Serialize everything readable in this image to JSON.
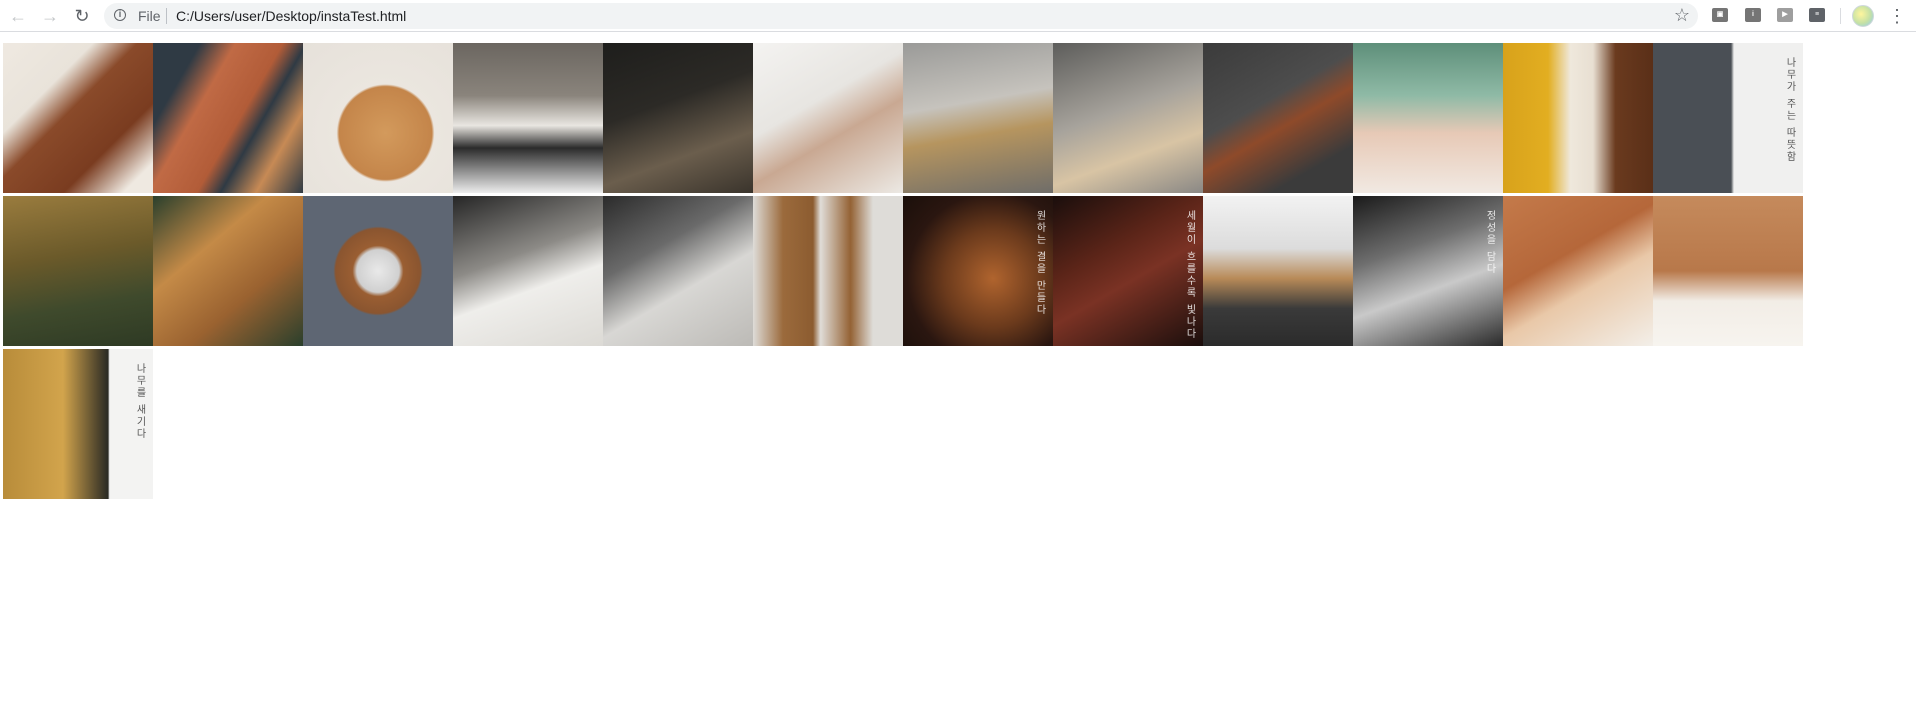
{
  "browser": {
    "scheme_label": "File",
    "url": "C:/Users/user/Desktop/instaTest.html",
    "icons": {
      "back": "arrow-left-icon",
      "forward": "arrow-right-icon",
      "reload": "reload-icon",
      "info": "info-icon",
      "star": "star-icon",
      "menu": "kebab-menu-icon"
    },
    "extensions": [
      "ext-1",
      "ext-2",
      "ext-3",
      "ext-4"
    ]
  },
  "grid": {
    "tiles": [
      {
        "name": "photo-cutting-board-wheat",
        "bg": "linear-gradient(135deg,#efe9e1 0%,#e9e3da 30%,#8a4a2a 45%,#7a3c20 70%,#efe9e1 90%)"
      },
      {
        "name": "photo-boards-dark-wheat",
        "bg": "linear-gradient(120deg,#2f3a44 0%,#2f3a44 20%,#c06a45 35%,#b25c38 55%,#2f3a44 65%,#c78a55 80%,#2f3a44 100%)"
      },
      {
        "name": "photo-round-board",
        "bg": "radial-gradient(circle at 55% 60%,#d39a5c 0%,#c4854a 38%,#ebe6df 40%,#e6e1da 100%)"
      },
      {
        "name": "photo-hands-lighthouse-cut",
        "bg": "linear-gradient(180deg,#6b6660 0%,#8a847c 35%,#e9e6e1 55%,#2b2b2b 70%,#ededed 100%)"
      },
      {
        "name": "photo-drill-press",
        "bg": "linear-gradient(160deg,#1e1e1c 0%,#2c2a26 40%,#6b5e4d 70%,#3a342c 100%)"
      },
      {
        "name": "photo-sketching-hand",
        "bg": "linear-gradient(150deg,#f4f3f1 0%,#e7e5e1 40%,#c9a892 60%,#ece9e4 100%)"
      },
      {
        "name": "photo-bandsaw",
        "bg": "linear-gradient(170deg,#9a9a98 0%,#c6c3bd 40%,#b6955f 60%,#6f6d69 100%)"
      },
      {
        "name": "photo-plank-hands",
        "bg": "linear-gradient(160deg,#5d5d5b 0%,#a7a39c 45%,#d8c4a4 70%,#8a8885 100%)"
      },
      {
        "name": "photo-sandwich-board",
        "bg": "linear-gradient(150deg,#3b3b3b 0%,#4d4d4d 40%,#8e4a2a 55%,#3b3b3b 80%)"
      },
      {
        "name": "photo-wood-shavings",
        "bg": "linear-gradient(180deg,#5e8f7a 0%,#8fbaa6 35%,#e7c9b6 60%,#f1e9e2 100%)"
      },
      {
        "name": "photo-slab-yellow",
        "bg": "linear-gradient(90deg,#d8a21b 0%,#e2ae21 30%,#efe8dc 45%,#e8dfd2 60%,#6a3a1e 75%,#5a2f18 100%)"
      },
      {
        "name": "photo-wall-hooks-text",
        "bg": "linear-gradient(90deg,#4a4f55 0%,#4a4f55 52%,#f0f0ef 54%,#f0f0ef 100%)",
        "cap": "나무가 주는 따뜻함",
        "dark": true
      },
      {
        "name": "photo-old-tree",
        "bg": "linear-gradient(170deg,#9a7c3e 0%,#6b5a2a 40%,#3f4a2c 70%,#2e3a24 100%)"
      },
      {
        "name": "photo-board-leaves",
        "bg": "linear-gradient(140deg,#2a3f2c 0%,#c48a47 35%,#9a6230 65%,#2a3f2c 100%)"
      },
      {
        "name": "photo-tray-cup",
        "bg": "radial-gradient(circle at 50% 50%,#e9e9e9 0%,#d0d0d0 20%,#9a5e32 24%,#8a5530 40%,#5e6673 42%,#5e6673 100%)"
      },
      {
        "name": "photo-planing-hand",
        "bg": "linear-gradient(160deg,#262626 0%,#8c8a86 40%,#efeeeb 60%,#dcdad5 100%)"
      },
      {
        "name": "photo-grinder",
        "bg": "linear-gradient(150deg,#2b2b2b 0%,#6a6a6a 35%,#d8d7d4 60%,#bcbab6 100%)"
      },
      {
        "name": "photo-three-boards",
        "bg": "linear-gradient(90deg,#dedcd8 0%,#9b6a3c 20%,#8c5c30 40%,#e0ddd8 45%,#946234 65%,#dedcd8 80%,#dedcd8 100%)"
      },
      {
        "name": "photo-wood-rings-text",
        "bg": "radial-gradient(circle at 60% 55%,#b0642e 0%,#6b3a1c 40%,#2a1610 70%,#1a0f0a 100%)",
        "cap": "원하는 결을 만들다"
      },
      {
        "name": "photo-carved-wood-text",
        "bg": "linear-gradient(150deg,#1a0e0c 0%,#5a2418 35%,#7a3224 55%,#1a0e0c 100%)",
        "cap": "세월이 흐를수록 빛나다"
      },
      {
        "name": "photo-kitchen",
        "bg": "linear-gradient(180deg,#f2f2f2 0%,#dcdcdc 35%,#b88a58 55%,#3a3a3a 75%,#2b2b2b 100%)"
      },
      {
        "name": "photo-lathe-bw",
        "bg": "linear-gradient(160deg,#1a1a1a 0%,#6e6e6e 35%,#c9c9c9 60%,#2a2a2a 100%)",
        "cap": "정성을 담다"
      },
      {
        "name": "photo-wooden-chair",
        "bg": "linear-gradient(150deg,#c47a4a 0%,#b5673a 40%,#e9c8a8 60%,#f3efe9 100%)"
      },
      {
        "name": "photo-shelf-table",
        "bg": "linear-gradient(180deg,#c58a5c 0%,#b8784a 50%,#f2ede6 70%,#f7f4ef 100%)"
      },
      {
        "name": "photo-lighthouse-panel-text",
        "bg": "linear-gradient(90deg,#b88c3a 0%,#d2a44c 40%,#2a2a24 70%,#f3f3f2 71%,#f3f3f2 100%)",
        "cap": "나무를 새기다",
        "dark": true
      }
    ]
  }
}
